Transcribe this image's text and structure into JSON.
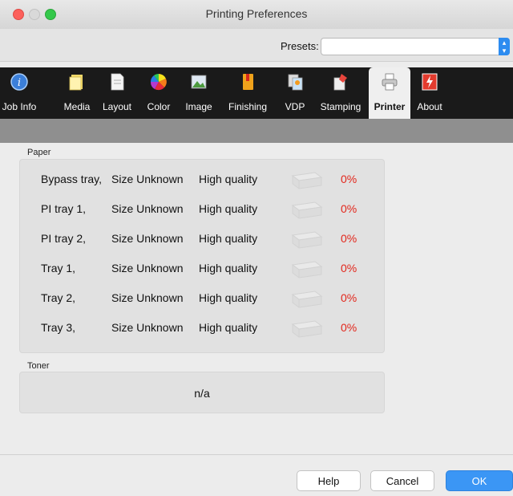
{
  "window": {
    "title": "Printing Preferences"
  },
  "presets": {
    "label": "Presets:",
    "value": ""
  },
  "tabs": [
    {
      "label": "Job Info",
      "icon": "info-icon"
    },
    {
      "label": "Media",
      "icon": "media-icon"
    },
    {
      "label": "Layout",
      "icon": "layout-icon"
    },
    {
      "label": "Color",
      "icon": "color-wheel-icon"
    },
    {
      "label": "Image",
      "icon": "image-icon"
    },
    {
      "label": "Finishing",
      "icon": "finishing-icon"
    },
    {
      "label": "VDP",
      "icon": "vdp-icon"
    },
    {
      "label": "Stamping",
      "icon": "stamping-icon"
    },
    {
      "label": "Printer",
      "icon": "printer-icon",
      "active": true
    },
    {
      "label": "About",
      "icon": "about-icon"
    }
  ],
  "paper": {
    "label": "Paper",
    "trays": [
      {
        "name": "Bypass tray,",
        "size": "Size Unknown",
        "quality": "High quality",
        "level": "0%"
      },
      {
        "name": "PI tray 1,",
        "size": "Size Unknown",
        "quality": "High quality",
        "level": "0%"
      },
      {
        "name": "PI tray 2,",
        "size": "Size Unknown",
        "quality": "High quality",
        "level": "0%"
      },
      {
        "name": "Tray 1,",
        "size": "Size Unknown",
        "quality": "High quality",
        "level": "0%"
      },
      {
        "name": "Tray 2,",
        "size": "Size Unknown",
        "quality": "High quality",
        "level": "0%"
      },
      {
        "name": "Tray 3,",
        "size": "Size Unknown",
        "quality": "High quality",
        "level": "0%"
      }
    ]
  },
  "toner": {
    "label": "Toner",
    "value": "n/a"
  },
  "buttons": {
    "help": "Help",
    "cancel": "Cancel",
    "ok": "OK"
  },
  "colors": {
    "accent": "#3b96f5",
    "level_text": "#e2261b",
    "toolbar": "#1a1a1a"
  }
}
